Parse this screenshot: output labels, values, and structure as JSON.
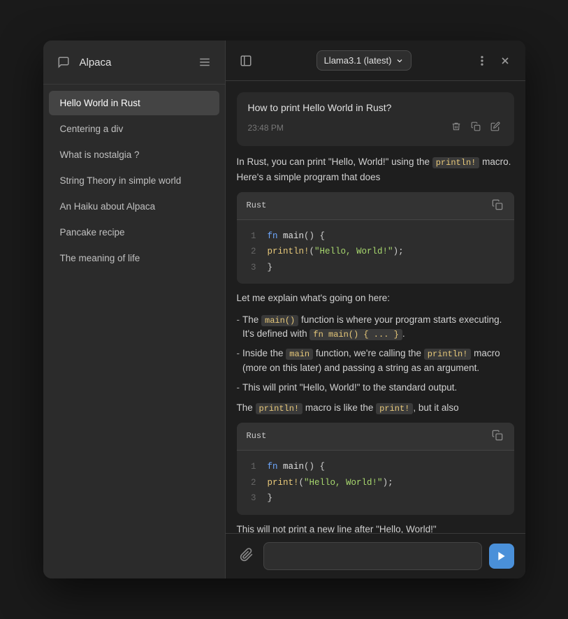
{
  "sidebar": {
    "title": "Alpaca",
    "items": [
      {
        "label": "Hello World in Rust",
        "active": true
      },
      {
        "label": "Centering a div",
        "active": false
      },
      {
        "label": "What is nostalgia ?",
        "active": false
      },
      {
        "label": "String Theory in simple world",
        "active": false
      },
      {
        "label": "An Haiku about Alpaca",
        "active": false
      },
      {
        "label": "Pancake recipe",
        "active": false
      },
      {
        "label": "The meaning of life",
        "active": false
      }
    ]
  },
  "header": {
    "model_label": "Llama3.1 (latest)"
  },
  "chat": {
    "user_message": "How to print Hello World in Rust?",
    "timestamp": "23:48 PM",
    "assistant_intro": "In Rust, you can print \"Hello, World!\" using the",
    "inline_code_1": "println!",
    "assistant_intro_2": "macro. Here's a simple program that does",
    "code_block_1": {
      "lang": "Rust",
      "lines": [
        {
          "num": "1",
          "tokens": [
            {
              "type": "kw",
              "text": "fn "
            },
            {
              "type": "fn",
              "text": "main"
            },
            {
              "type": "plain",
              "text": "() {"
            }
          ]
        },
        {
          "num": "2",
          "tokens": [
            {
              "type": "macro",
              "text": "    println!"
            },
            {
              "type": "plain",
              "text": "("
            },
            {
              "type": "string",
              "text": "\"Hello, World!\""
            },
            {
              "type": "plain",
              "text": ");"
            }
          ]
        },
        {
          "num": "3",
          "tokens": [
            {
              "type": "plain",
              "text": "}"
            }
          ]
        }
      ]
    },
    "explain_title": "Let me explain what's going on here:",
    "bullets": [
      {
        "prefix": "- The ",
        "code": "main()",
        "suffix": " function is where your program starts executing. It's defined with ",
        "code2": "fn main() { ... }",
        "suffix2": "."
      },
      {
        "prefix": "- Inside the ",
        "code": "main",
        "suffix": " function, we're calling the ",
        "code2": "println!",
        "suffix2": " macro (more on this later) and passing a string as an argument."
      },
      {
        "prefix": "- This will print \"Hello, World!\" to the standard output."
      }
    ],
    "println_desc_prefix": "The ",
    "println_code": "println!",
    "println_desc_mid": " macro is like the ",
    "print_code": "print!",
    "println_desc_suffix": ", but it also",
    "code_block_2": {
      "lang": "Rust",
      "lines": [
        {
          "num": "1",
          "tokens": [
            {
              "type": "kw",
              "text": "fn "
            },
            {
              "type": "fn",
              "text": "main"
            },
            {
              "type": "plain",
              "text": "() {"
            }
          ]
        },
        {
          "num": "2",
          "tokens": [
            {
              "type": "macro",
              "text": "    print!"
            },
            {
              "type": "plain",
              "text": "("
            },
            {
              "type": "string",
              "text": "\"Hello, World!\""
            },
            {
              "type": "plain",
              "text": ");"
            }
          ]
        },
        {
          "num": "3",
          "tokens": [
            {
              "type": "plain",
              "text": "}"
            }
          ]
        }
      ]
    },
    "footer_note": "This will not print a new line after \"Hello, World!\""
  },
  "input": {
    "placeholder": ""
  },
  "icons": {
    "chat_icon": "💬",
    "menu_icon": "☰",
    "sidebar_toggle": "▣",
    "chevron_down": "▾",
    "more_icon": "⋮",
    "close_icon": "✕",
    "delete_icon": "🗑",
    "copy_icon": "⧉",
    "edit_icon": "✎",
    "send_icon": "▶",
    "attach_icon": "⛓"
  }
}
